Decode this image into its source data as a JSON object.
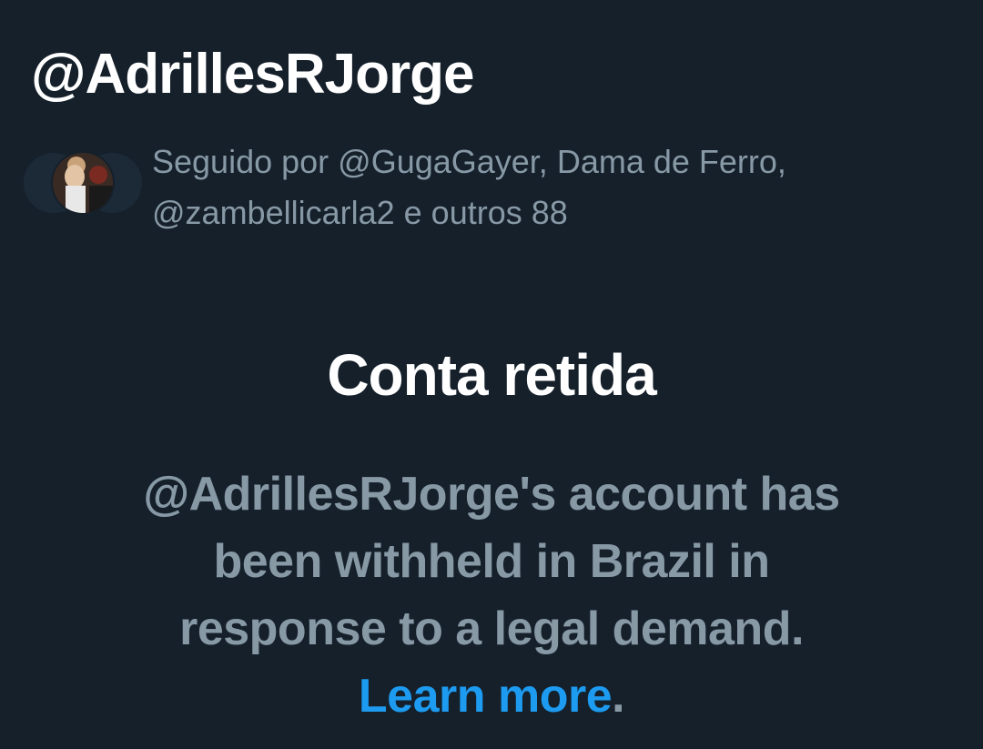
{
  "profile": {
    "handle": "@AdrillesRJorge"
  },
  "followers": {
    "text_line1": "Seguido por @GugaGayer, Dama de Ferro,",
    "text_line2": "@zambellicarla2 e outros 88"
  },
  "withheld": {
    "title": "Conta retida",
    "message": "@AdrillesRJorge's account has been withheld in Brazil in response to a legal demand.",
    "link_label": "Learn more",
    "trailing": "."
  },
  "colors": {
    "background": "#15202b",
    "primary_text": "#ffffff",
    "secondary_text": "#8899a6",
    "link": "#1d9bf0"
  },
  "icons": [
    "avatar"
  ]
}
